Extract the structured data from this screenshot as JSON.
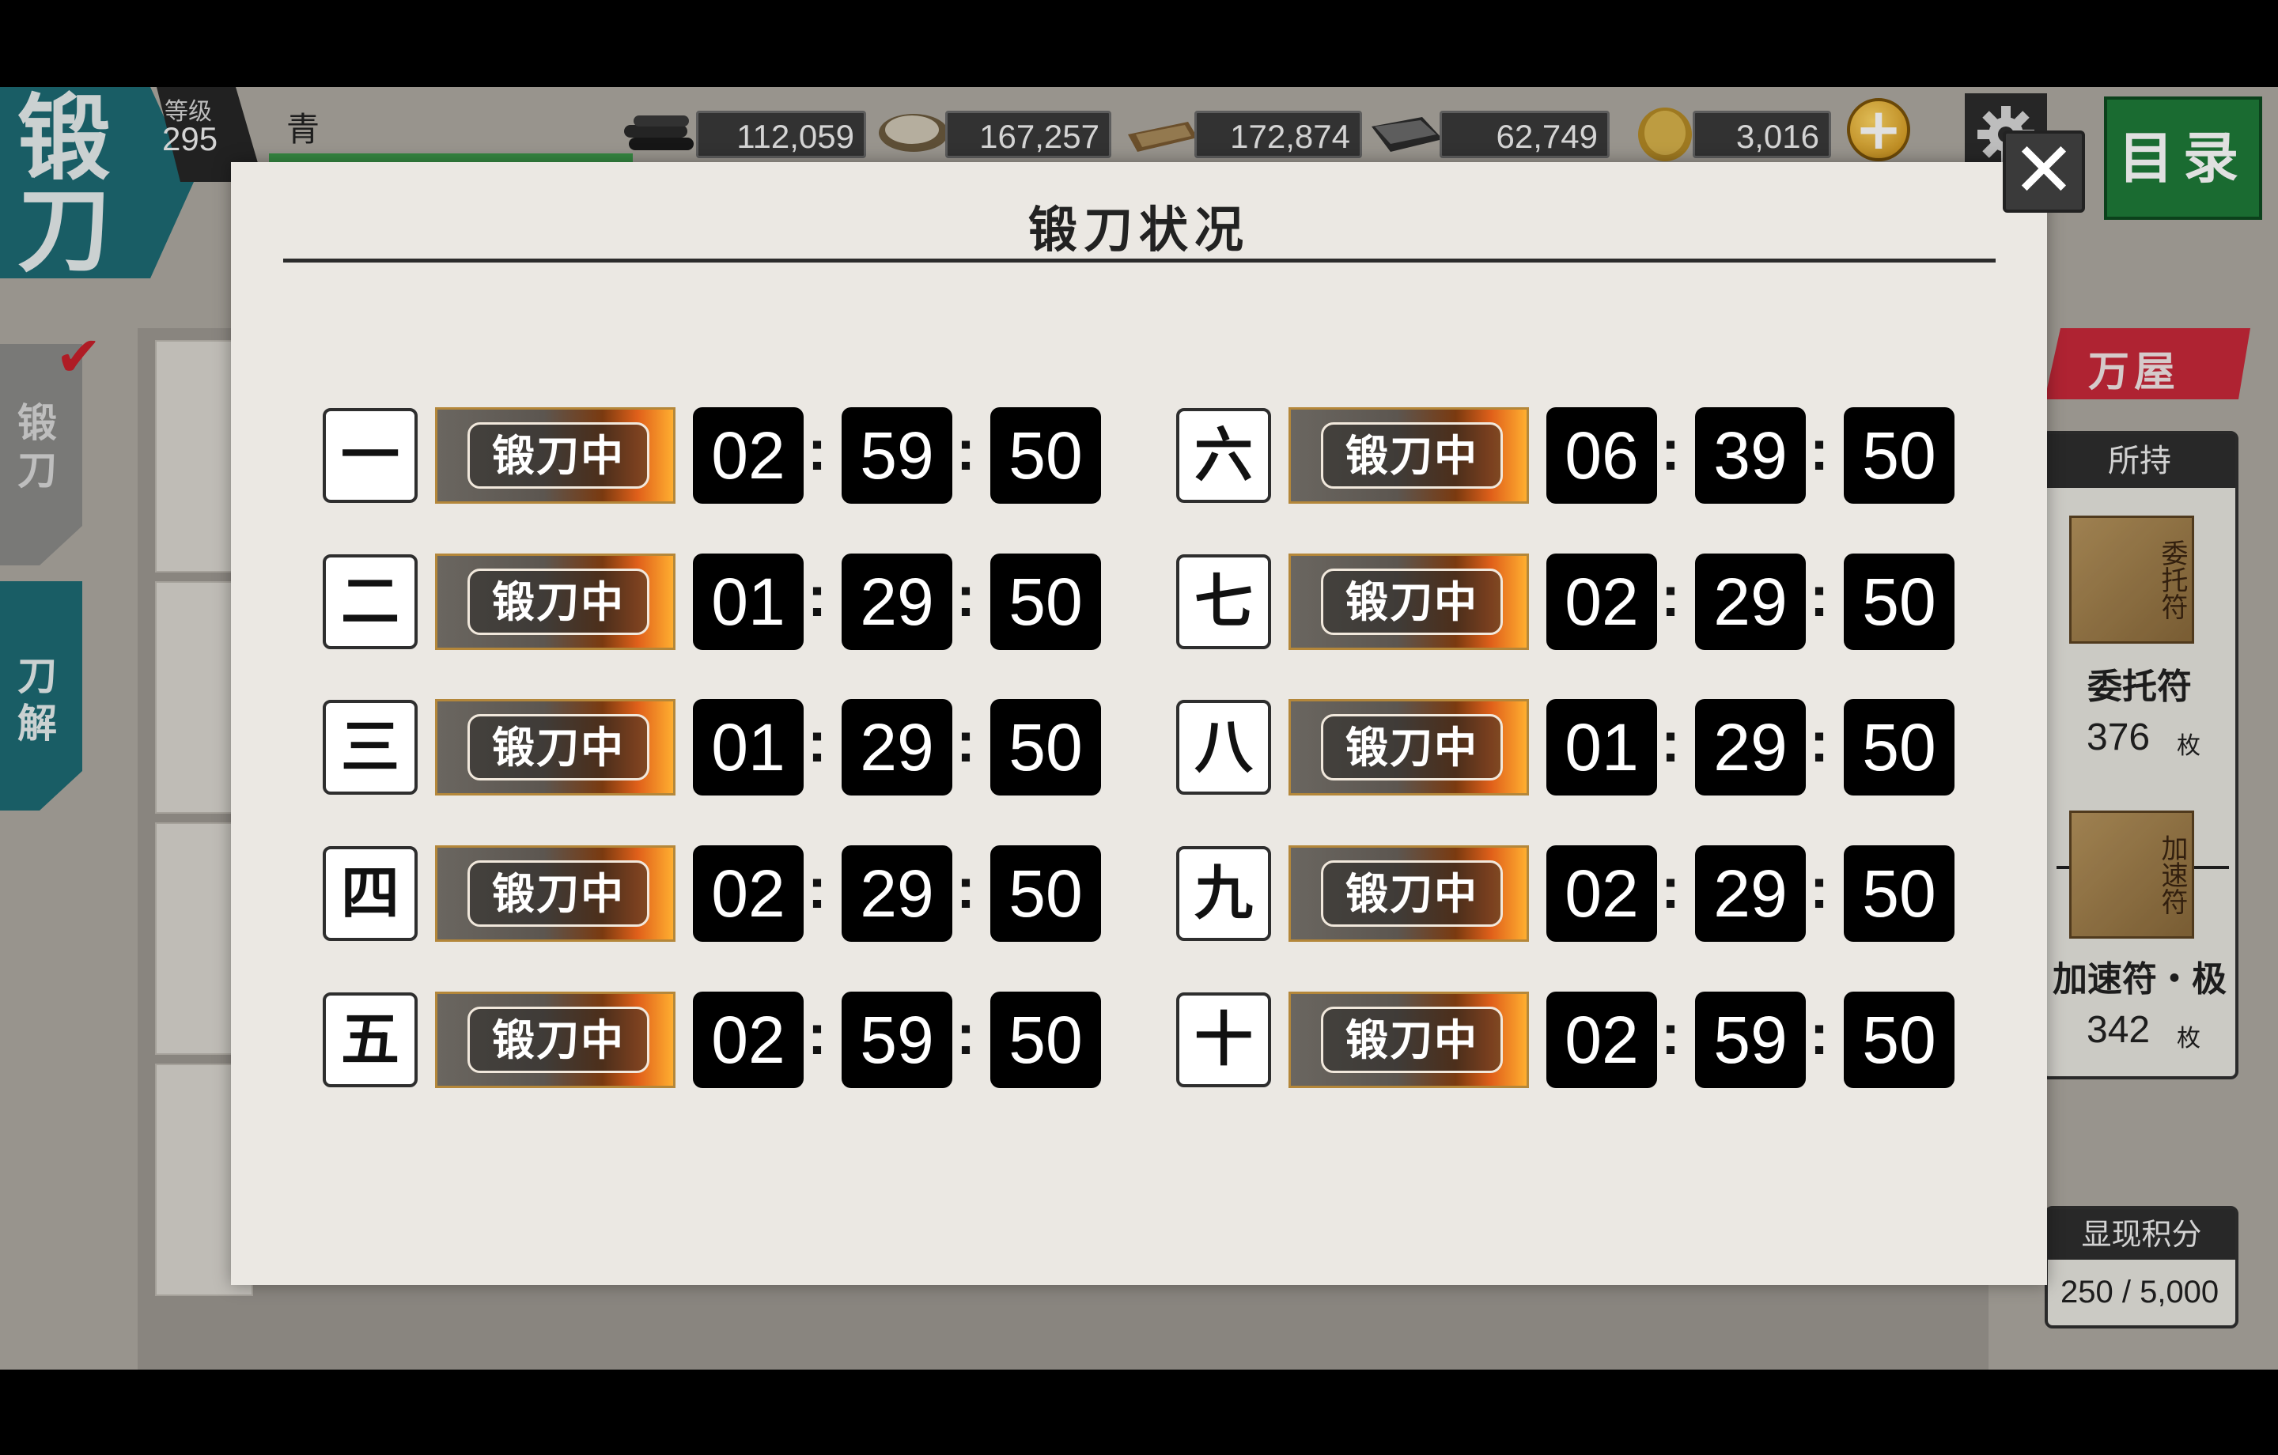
{
  "screen": {
    "title": "锻刀",
    "level_label": "等级",
    "level_value": "295",
    "player_name": "青",
    "resources": [
      {
        "icon": "charcoal-icon",
        "value": "112,059"
      },
      {
        "icon": "steel-icon",
        "value": "167,257"
      },
      {
        "icon": "coolant-icon",
        "value": "172,874"
      },
      {
        "icon": "whetstone-icon",
        "value": "62,749"
      }
    ],
    "coins": {
      "icon": "koban-coin-icon",
      "value": "3,016",
      "plus": "+"
    },
    "menu_label": "目录",
    "side_tabs": [
      {
        "label": "锻刀",
        "active": true
      },
      {
        "label": "刀解",
        "active": false
      }
    ],
    "shop_label": "万屋",
    "owned": {
      "header": "所持",
      "items": [
        {
          "icon_text": "委托符",
          "name": "委托符",
          "count": "376",
          "unit": "枚"
        },
        {
          "icon_text": "加速符",
          "name": "加速符・极",
          "count": "342",
          "unit": "枚"
        }
      ]
    },
    "points": {
      "header": "显现积分",
      "value": "250 / 5,000"
    }
  },
  "modal": {
    "title": "锻刀状况",
    "close": "✕",
    "status_label": "锻刀中",
    "separator": ":",
    "slots": [
      {
        "number": "一",
        "h": "02",
        "m": "59",
        "s": "50"
      },
      {
        "number": "二",
        "h": "01",
        "m": "29",
        "s": "50"
      },
      {
        "number": "三",
        "h": "01",
        "m": "29",
        "s": "50"
      },
      {
        "number": "四",
        "h": "02",
        "m": "29",
        "s": "50"
      },
      {
        "number": "五",
        "h": "02",
        "m": "59",
        "s": "50"
      },
      {
        "number": "六",
        "h": "06",
        "m": "39",
        "s": "50"
      },
      {
        "number": "七",
        "h": "02",
        "m": "29",
        "s": "50"
      },
      {
        "number": "八",
        "h": "01",
        "m": "29",
        "s": "50"
      },
      {
        "number": "九",
        "h": "02",
        "m": "29",
        "s": "50"
      },
      {
        "number": "十",
        "h": "02",
        "m": "59",
        "s": "50"
      }
    ]
  }
}
